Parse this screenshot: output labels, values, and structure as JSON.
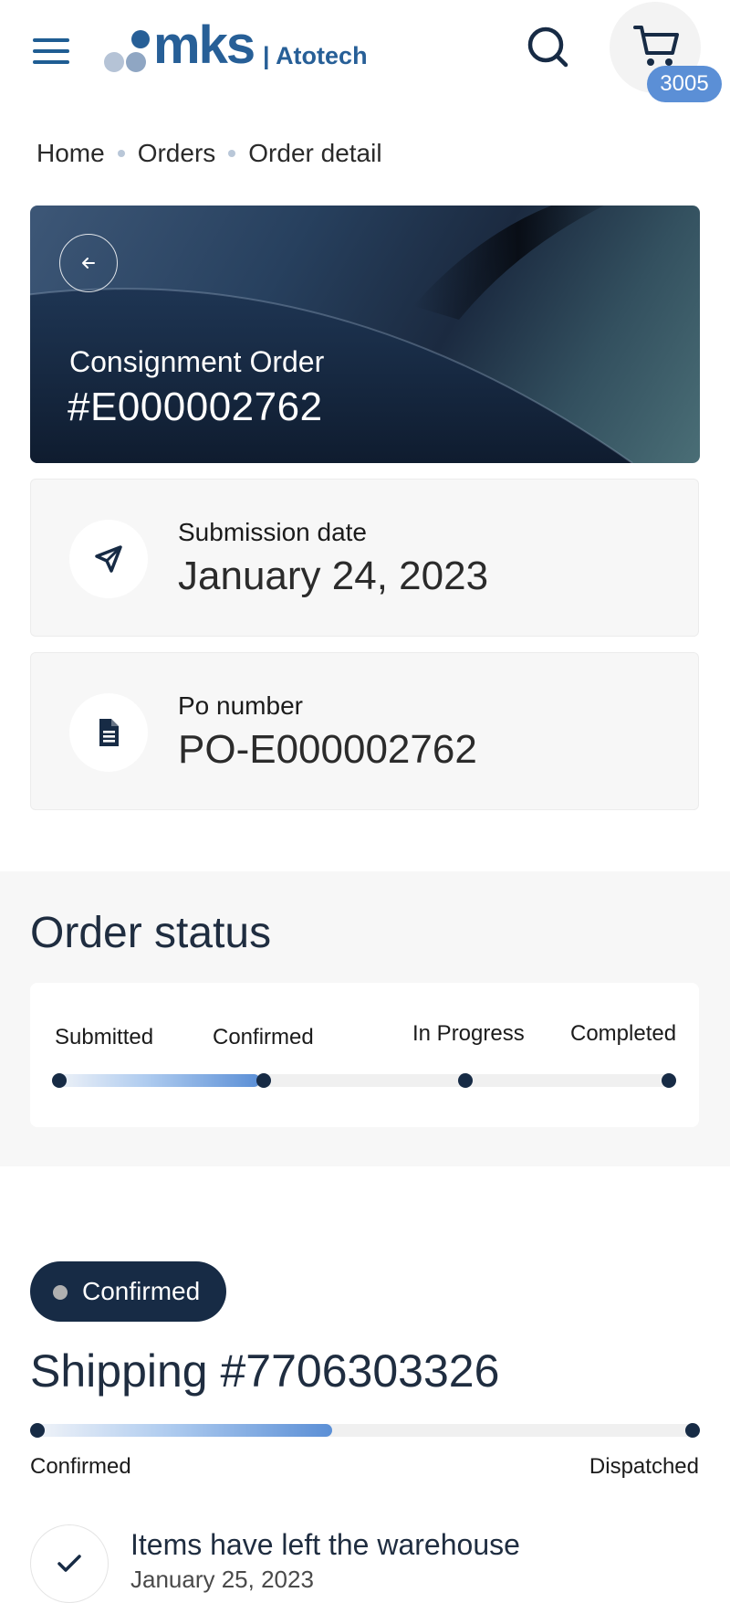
{
  "header": {
    "brand_primary": "mks",
    "brand_secondary": "Atotech",
    "cart_count": "3005",
    "accent_color": "#275f97"
  },
  "breadcrumb": [
    "Home",
    "Orders",
    "Order detail"
  ],
  "order": {
    "type": "Consignment Order",
    "number": "#E000002762"
  },
  "info": {
    "submission_label": "Submission date",
    "submission_value": "January 24, 2023",
    "po_label": "Po number",
    "po_value": "PO-E000002762"
  },
  "order_status": {
    "title": "Order status",
    "steps": [
      "Submitted",
      "Confirmed",
      "In Progress",
      "Completed"
    ],
    "current_step_index": 1,
    "progress_fraction": 0.333
  },
  "shipping": {
    "status_badge": "Confirmed",
    "title": "Shipping #7706303326",
    "start_label": "Confirmed",
    "end_label": "Dispatched",
    "progress_fraction": 0.45,
    "event_title": "Items have left the warehouse",
    "event_date": "January 25, 2023"
  }
}
